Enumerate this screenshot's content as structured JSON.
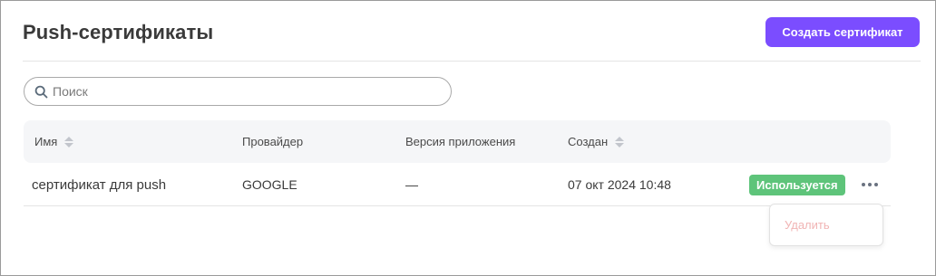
{
  "header": {
    "title": "Push-сертификаты",
    "create_button": "Создать сертификат"
  },
  "search": {
    "placeholder": "Поиск",
    "value": ""
  },
  "table": {
    "columns": [
      {
        "label": "Имя",
        "sortable": true
      },
      {
        "label": "Провайдер",
        "sortable": false
      },
      {
        "label": "Версия приложения",
        "sortable": false
      },
      {
        "label": "Создан",
        "sortable": true
      }
    ],
    "rows": [
      {
        "name": "сертификат для push",
        "provider": "GOOGLE",
        "app_version": "—",
        "created": "07 окт 2024 10:48",
        "status": "Используется"
      }
    ]
  },
  "row_menu": {
    "items": [
      {
        "label": "Удалить",
        "disabled": true
      }
    ]
  },
  "colors": {
    "accent": "#7b4dff",
    "status_active": "#5ec47a",
    "danger_disabled": "#f1b4b4"
  },
  "icons": {
    "search": "search-icon",
    "sort": "sort-icon",
    "more": "more-horizontal-icon"
  }
}
